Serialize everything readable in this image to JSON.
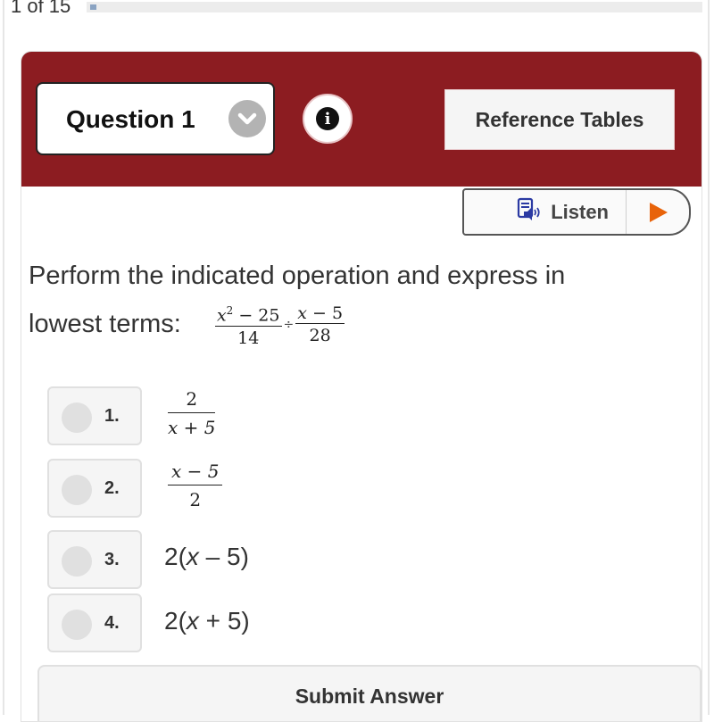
{
  "progress": {
    "label": "1 of 15",
    "current": 1,
    "total": 15,
    "fraction": 0.0067,
    "color": "#8aa3c2"
  },
  "header": {
    "background_color": "#8c1c21",
    "question_select": {
      "label": "Question 1",
      "icon": "chevron-down-icon"
    },
    "info_button": {
      "icon": "info-icon",
      "glyph": "i"
    },
    "reference_button": {
      "label": "Reference Tables"
    }
  },
  "listen": {
    "label": "Listen",
    "icon": "speaker-document-icon",
    "play_icon": "play-icon",
    "play_color": "#e8630a",
    "icon_color": "#2b3aa3"
  },
  "question": {
    "prompt_line1": "Perform the indicated operation and express in",
    "prompt_line2": "lowest terms:",
    "expression": {
      "left": {
        "numerator_var": "x",
        "numerator_exp": "2",
        "numerator_rest": " − 25",
        "denominator": "14"
      },
      "operator": "÷",
      "right": {
        "numerator_var": "x",
        "numerator_rest": " − 5",
        "denominator": "28"
      }
    }
  },
  "options": [
    {
      "number": "1.",
      "type": "fraction",
      "numerator": "2",
      "denominator": "x + 5",
      "selected": false
    },
    {
      "number": "2.",
      "type": "fraction",
      "numerator": "x − 5",
      "denominator": "2",
      "selected": false
    },
    {
      "number": "3.",
      "type": "expression",
      "prefix": "2(",
      "var": "x",
      "suffix": " – 5)",
      "selected": false
    },
    {
      "number": "4.",
      "type": "expression",
      "prefix": "2(",
      "var": "x",
      "suffix": " + 5)",
      "selected": false
    }
  ],
  "submit": {
    "label": "Submit Answer"
  }
}
